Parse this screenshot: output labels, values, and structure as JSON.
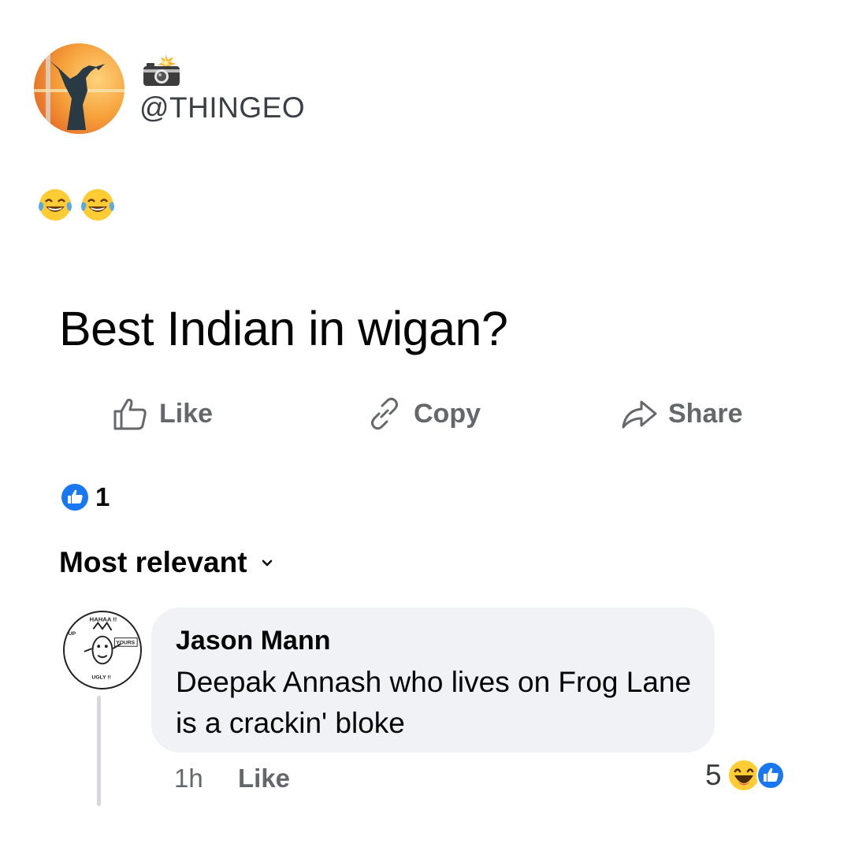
{
  "post": {
    "handle": "@THINGEO",
    "header_icon": "camera-with-flash-icon",
    "emojis": [
      "face-with-tears-of-joy-icon",
      "face-with-tears-of-joy-icon"
    ],
    "text": "Best Indian in wigan?"
  },
  "actions": {
    "like_label": "Like",
    "copy_label": "Copy",
    "share_label": "Share"
  },
  "reactions": {
    "count": "1",
    "icon": "like-badge-icon"
  },
  "comments_sort": {
    "label": "Most relevant"
  },
  "comment": {
    "author": "Jason Mann",
    "text": "Deepak Annash who lives on Frog Lane is a crackin' bloke",
    "time": "1h",
    "like_label": "Like",
    "reaction_count": "5",
    "reaction_icons": [
      "haha-icon",
      "like-badge-icon"
    ],
    "avatar_labels": [
      "HAHAA !!",
      "UP",
      "YOURS",
      "UGLY !!"
    ]
  },
  "colors": {
    "accent_blue": "#1877f2",
    "muted_text": "#65676b",
    "bubble_bg": "#f0f2f5"
  }
}
